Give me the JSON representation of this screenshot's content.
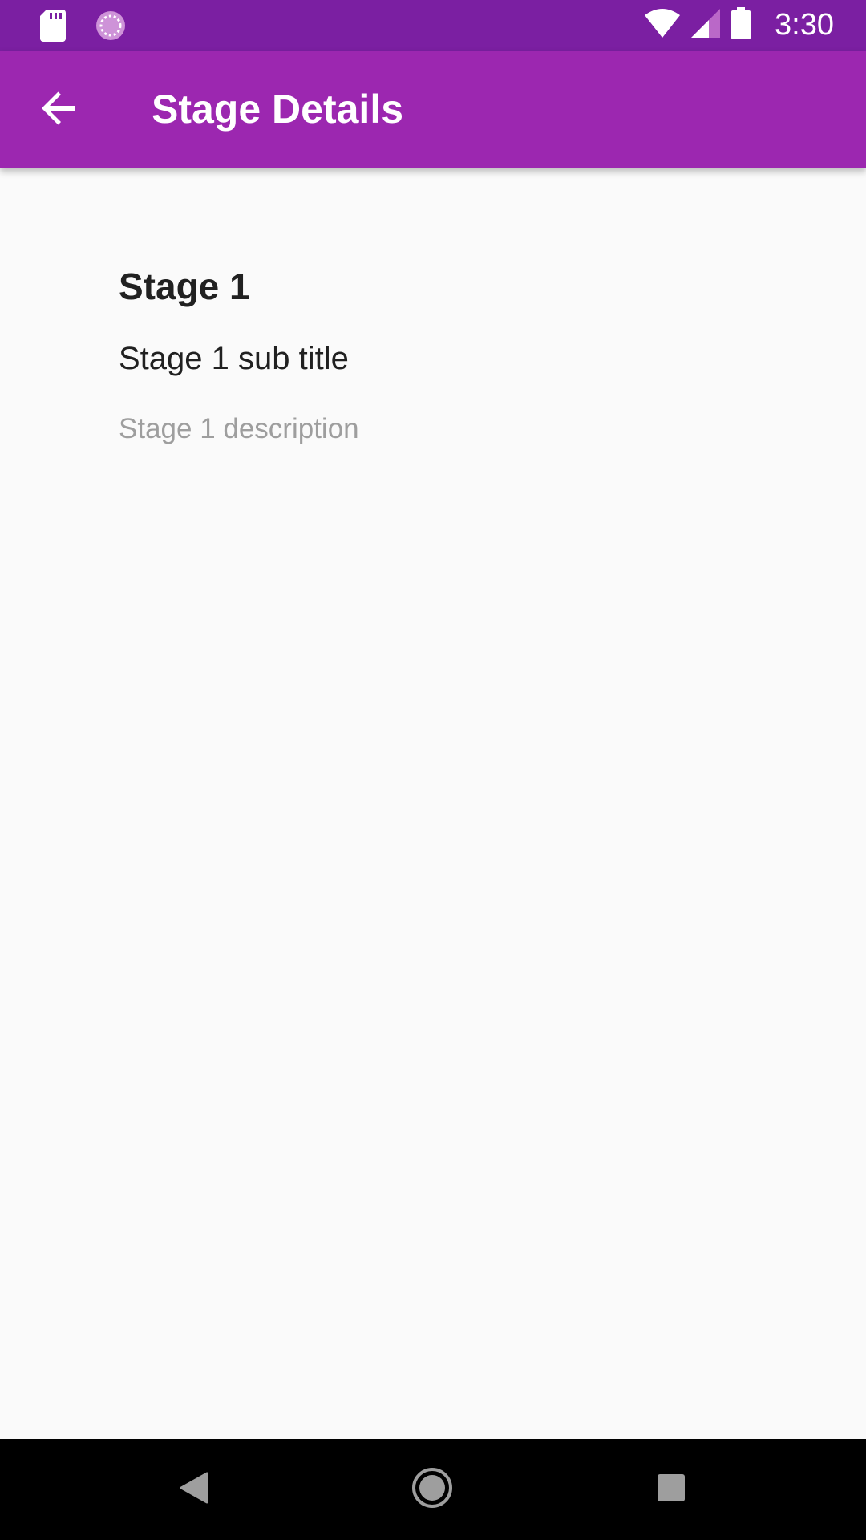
{
  "status_bar": {
    "time": "3:30",
    "icons": [
      "sd-card-icon",
      "sync-icon",
      "wifi-icon",
      "signal-icon",
      "battery-icon"
    ],
    "color": "#7b1fa2"
  },
  "app_bar": {
    "title": "Stage Details",
    "back_icon": "arrow-back-icon",
    "color": "#9c27b0"
  },
  "stage": {
    "title": "Stage 1",
    "subtitle": "Stage 1 sub title",
    "description": "Stage 1 description"
  },
  "nav_bar": {
    "icons": [
      "nav-back-icon",
      "nav-home-icon",
      "nav-recents-icon"
    ]
  }
}
